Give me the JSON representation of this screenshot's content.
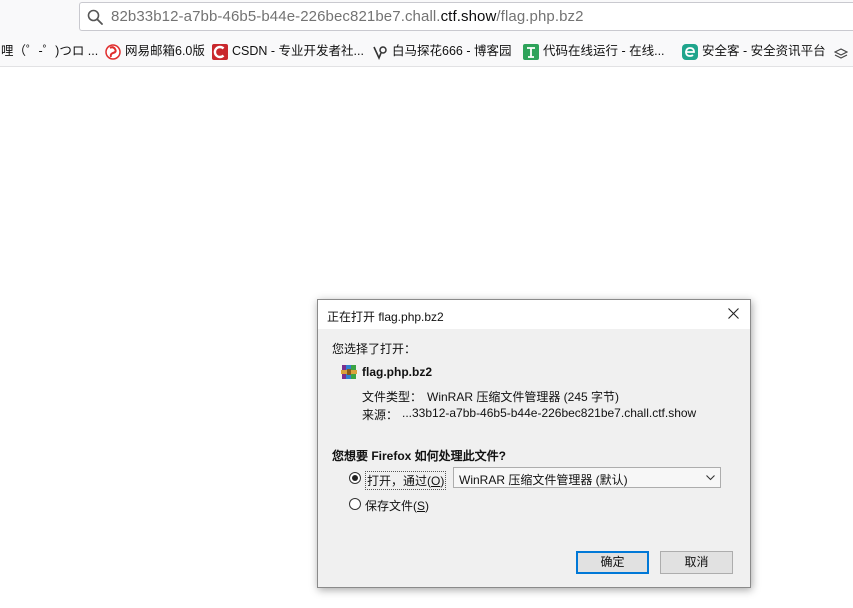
{
  "browser": {
    "url_prefix": "82b33b12-a7bb-46b5-b44e-226bec821be7.chall.",
    "url_domain": "ctf.show",
    "url_path": "/flag.php.bz2",
    "bookmarks": [
      {
        "label": "哩（゜-゜)つロ ...",
        "icon": "bilibili-icon"
      },
      {
        "label": "网易邮箱6.0版",
        "icon": "netease-mail-icon"
      },
      {
        "label": "CSDN - 专业开发者社...",
        "icon": "csdn-icon"
      },
      {
        "label": "白马探花666 - 博客园",
        "icon": "cnblogs-icon"
      },
      {
        "label": "代码在线运行 - 在线...",
        "icon": "code-runner-icon"
      },
      {
        "label": "安全客 - 安全资讯平台",
        "icon": "anquanke-icon"
      }
    ]
  },
  "dialog": {
    "title": "正在打开 flag.php.bz2",
    "chosen_label": "您选择了打开：",
    "file_name": "flag.php.bz2",
    "type_label": "文件类型：",
    "type_value": "WinRAR 压缩文件管理器 (245 字节)",
    "source_label": "来源：",
    "source_value": "...33b12-a7bb-46b5-b44e-226bec821be7.chall.ctf.show",
    "question": "您想要 Firefox 如何处理此文件?",
    "open_with_label": "打开，通过(",
    "open_with_key": "O",
    "open_with_close": ")",
    "open_with_value": "WinRAR 压缩文件管理器 (默认)",
    "save_label": "保存文件(",
    "save_key": "S",
    "save_close": ")",
    "ok": "确定",
    "cancel": "取消",
    "selected_option": "open"
  },
  "colors": {
    "accent": "#0078d7",
    "csdn_red": "#c9282d",
    "mail_red": "#e02d2d",
    "code_green": "#2ea35a",
    "anquanke_teal": "#1fa58c"
  }
}
